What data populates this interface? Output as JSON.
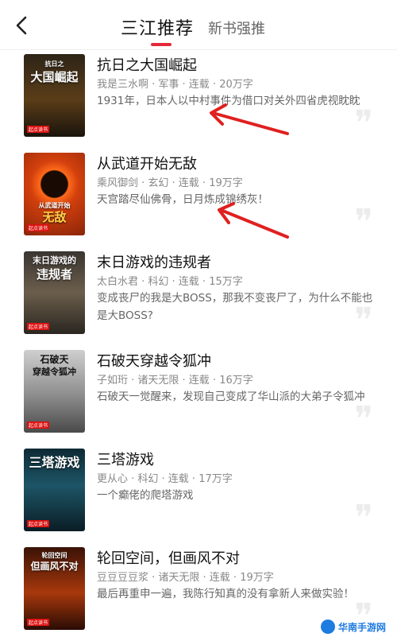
{
  "header": {
    "active_tab": "三江推荐",
    "inactive_tab": "新书强推"
  },
  "books": [
    {
      "title": "抗日之大国崛起",
      "meta": "我是三水啊 · 军事 · 连载 · 20万字",
      "desc": "1931年，日本人以中村事件为借口对关外四省虎视眈眈",
      "cover_small": "抗日之",
      "cover_big": "大国崛起",
      "cover_bg": "#3a2c1a"
    },
    {
      "title": "从武道开始无敌",
      "meta": "乘风御剑 · 玄幻 · 连载 · 19万字",
      "desc": "天宫踏尽仙佛骨，日月炼成锦绣灰！",
      "cover_small": "从武道开始",
      "cover_big": "无敌",
      "cover_bg": "#b8420e"
    },
    {
      "title": "末日游戏的违规者",
      "meta": "太白水君 · 科幻 · 连载 · 15万字",
      "desc": "变成丧尸的我是大BOSS，那我不变丧尸了，为什么不能也是大BOSS?",
      "cover_small": "末日游戏的",
      "cover_big": "违规者",
      "cover_bg": "#4b4337"
    },
    {
      "title": "石破天穿越令狐冲",
      "meta": "子如珩 · 诸天无限 · 连载 · 16万字",
      "desc": "石破天一觉醒来，发现自己变成了华山派的大弟子令狐冲",
      "cover_small": "石破天",
      "cover_big": "穿越令狐冲",
      "cover_bg": "#6b6b6b"
    },
    {
      "title": "三塔游戏",
      "meta": "更从心 · 科幻 · 连载 · 17万字",
      "desc": "一个癫佬的爬塔游戏",
      "cover_small": "",
      "cover_big": "三塔游戏",
      "cover_bg": "#123a4a"
    },
    {
      "title": "轮回空间，但画风不对",
      "meta": "豆豆豆豆浆 · 诸天无限 · 连载 · 19万字",
      "desc": "最后再重申一遍，我陈行知真的没有拿新人来做实验！",
      "cover_small": "轮回空间",
      "cover_big": "但画风不对",
      "cover_bg": "#5a1a08"
    }
  ],
  "cover_brand": "起点读书",
  "watermark": "华南手游网",
  "accent_color": "#e5293b"
}
